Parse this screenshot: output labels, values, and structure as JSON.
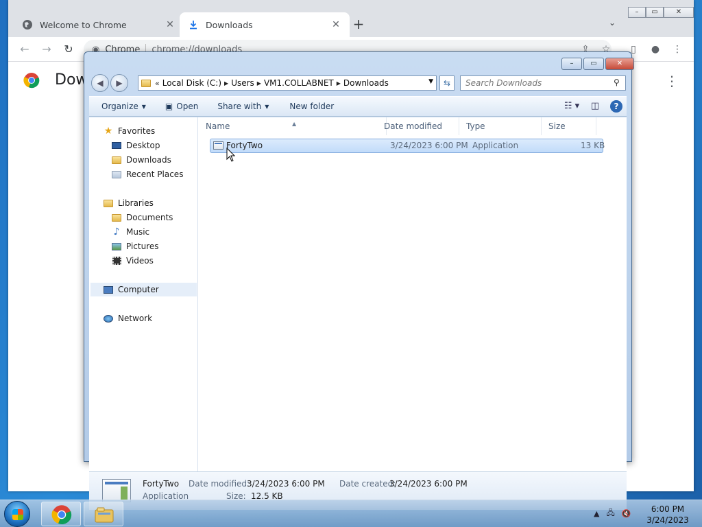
{
  "chrome": {
    "tabs": [
      {
        "title": "Welcome to Chrome"
      },
      {
        "title": "Downloads"
      }
    ],
    "omnibox": {
      "chip": "Chrome",
      "url": "chrome://downloads"
    },
    "page_title": "Dow"
  },
  "explorer": {
    "breadcrumb": [
      "Local Disk (C:)",
      "Users",
      "VM1.COLLABNET",
      "Downloads"
    ],
    "search_placeholder": "Search Downloads",
    "commands": {
      "organize": "Organize",
      "open": "Open",
      "share_with": "Share with",
      "new_folder": "New folder"
    },
    "nav": {
      "favorites": "Favorites",
      "desktop": "Desktop",
      "downloads": "Downloads",
      "recent_places": "Recent Places",
      "libraries": "Libraries",
      "documents": "Documents",
      "music": "Music",
      "pictures": "Pictures",
      "videos": "Videos",
      "computer": "Computer",
      "network": "Network"
    },
    "columns": {
      "name": "Name",
      "date_modified": "Date modified",
      "type": "Type",
      "size": "Size"
    },
    "files": [
      {
        "name": "FortyTwo",
        "date_modified": "3/24/2023 6:00 PM",
        "type": "Application",
        "size": "13 KB"
      }
    ],
    "details": {
      "name": "FortyTwo",
      "type": "Application",
      "date_modified_label": "Date modified:",
      "date_modified": "3/24/2023 6:00 PM",
      "date_created_label": "Date created:",
      "date_created": "3/24/2023 6:00 PM",
      "size_label": "Size:",
      "size": "12.5 KB"
    }
  },
  "taskbar": {
    "time": "6:00 PM",
    "date": "3/24/2023"
  },
  "colors": {
    "chrome_frame": "#dee1e6",
    "explorer_frame": "#c9dcf2",
    "selection": "#c1dbfa",
    "taskbar": "#9ab8d8"
  }
}
